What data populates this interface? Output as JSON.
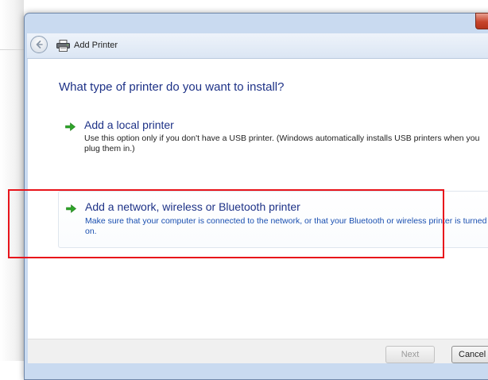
{
  "window": {
    "title": "Add Printer"
  },
  "page": {
    "heading": "What type of printer do you want to install?"
  },
  "options": [
    {
      "title": "Add a local printer",
      "description": "Use this option only if you don't have a USB printer. (Windows automatically installs USB printers when you plug them in.)"
    },
    {
      "title": "Add a network, wireless or Bluetooth printer",
      "description": "Make sure that your computer is connected to the network, or that your Bluetooth or wireless printer is turned on."
    }
  ],
  "footer": {
    "next_label": "Next",
    "cancel_label": "Cancel"
  },
  "icons": {
    "back": "back-arrow-icon",
    "printer": "printer-icon",
    "option_arrow": "green-arrow-icon"
  },
  "colors": {
    "heading": "#1e3287",
    "link_desc": "#1a4fb0",
    "arrow": "#2fa52a",
    "highlight": "#e8141b"
  }
}
